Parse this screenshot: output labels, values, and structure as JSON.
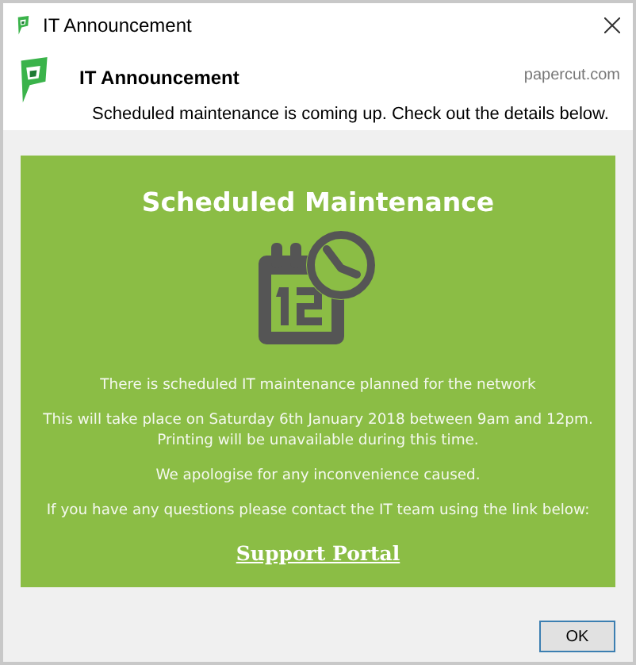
{
  "window": {
    "title": "IT Announcement"
  },
  "header": {
    "title": "IT Announcement",
    "source": "papercut.com",
    "message": "Scheduled maintenance is coming up. Check out the details below."
  },
  "panel": {
    "heading": "Scheduled Maintenance",
    "paragraphs": [
      "There is scheduled IT maintenance planned for the network",
      "This will take place on Saturday 6th January 2018 between 9am and 12pm.\nPrinting will be unavailable during this time.",
      "We apologise for any inconvenience caused.",
      "If you have any questions please contact the IT team using the link below:"
    ],
    "link": "Support Portal"
  },
  "buttons": [
    "OK"
  ]
}
